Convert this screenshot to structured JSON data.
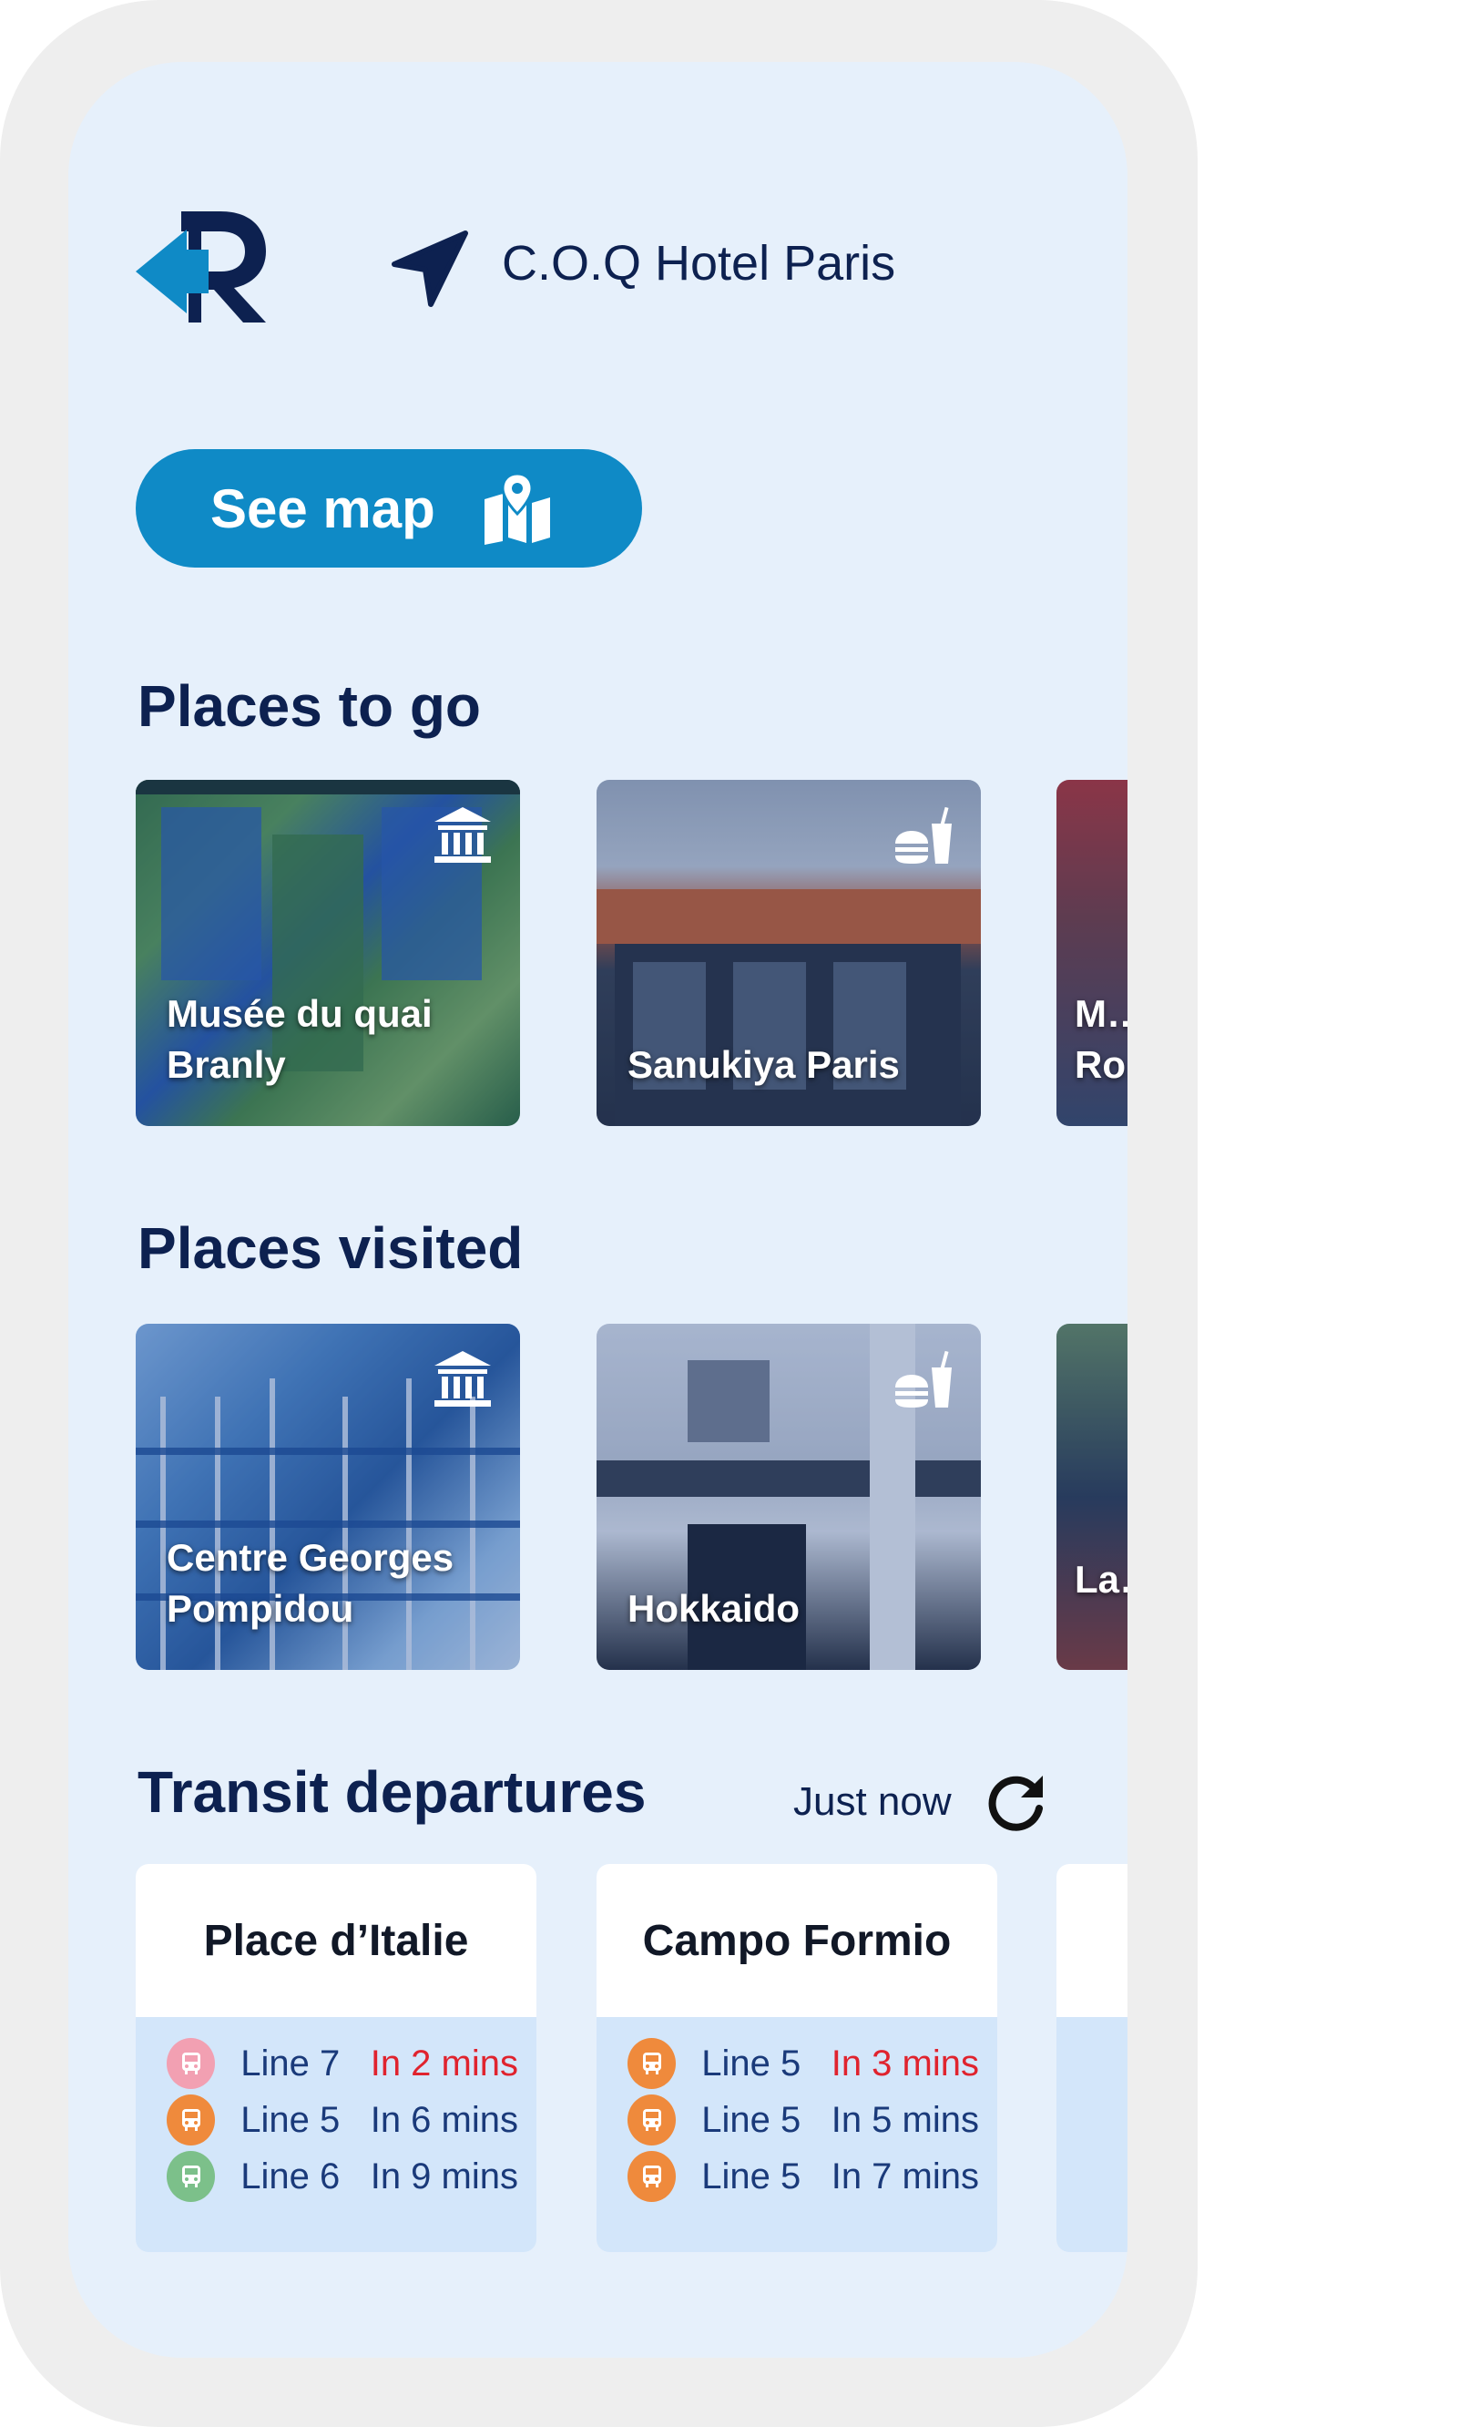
{
  "header": {
    "location_name": "C.O.Q Hotel Paris",
    "logo_icon": "r-arrow-logo",
    "location_icon": "navigation-arrow-icon"
  },
  "map_button": {
    "label": "See map",
    "icon": "map-pin-icon"
  },
  "places_to_go": {
    "title": "Places to go",
    "cards": [
      {
        "name": "Musée du quai Branly",
        "category_icon": "museum-icon"
      },
      {
        "name": "Sanukiya Paris",
        "category_icon": "fast-food-icon"
      },
      {
        "name": "M… Ro…",
        "category_icon": ""
      }
    ]
  },
  "places_visited": {
    "title": "Places visited",
    "cards": [
      {
        "name": "Centre Georges Pompidou",
        "category_icon": "museum-icon"
      },
      {
        "name": "Hokkaido",
        "category_icon": "fast-food-icon"
      },
      {
        "name": "La…",
        "category_icon": ""
      }
    ]
  },
  "transit": {
    "title": "Transit departures",
    "updated": "Just now",
    "refresh_icon": "refresh-icon",
    "stops": [
      {
        "name": "Place d’Italie",
        "departures": [
          {
            "line": "Line 7",
            "eta": "In 2 mins",
            "color": "#f2a0b2",
            "soon": true
          },
          {
            "line": "Line 5",
            "eta": "In 6 mins",
            "color": "#ef8a3c",
            "soon": false
          },
          {
            "line": "Line 6",
            "eta": "In 9 mins",
            "color": "#7cc08a",
            "soon": false
          }
        ]
      },
      {
        "name": "Campo Formio",
        "departures": [
          {
            "line": "Line 5",
            "eta": "In 3 mins",
            "color": "#ef8a3c",
            "soon": true
          },
          {
            "line": "Line 5",
            "eta": "In 5 mins",
            "color": "#ef8a3c",
            "soon": false
          },
          {
            "line": "Line 5",
            "eta": "In 7 mins",
            "color": "#ef8a3c",
            "soon": false
          }
        ]
      }
    ]
  },
  "colors": {
    "accent": "#0f8ac6",
    "navy": "#0d2150",
    "screen_bg": "#e6f0fb",
    "eta_soon": "#e0232e"
  }
}
